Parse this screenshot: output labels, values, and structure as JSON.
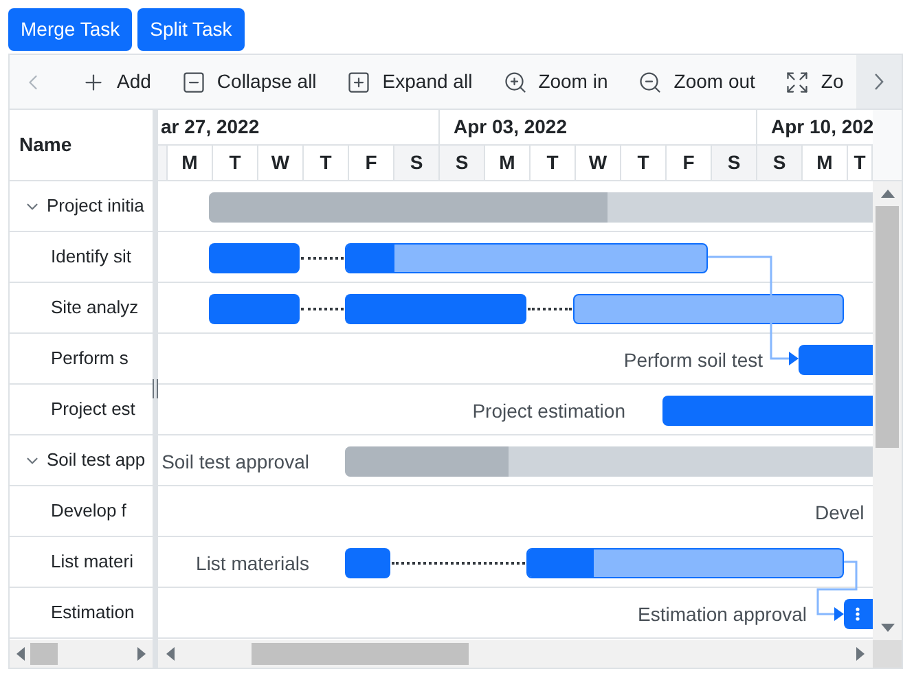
{
  "buttons": [
    {
      "label": "Merge Task"
    },
    {
      "label": "Split Task"
    }
  ],
  "toolbar": {
    "items": [
      {
        "kind": "add",
        "label": "Add"
      },
      {
        "kind": "collapse",
        "label": "Collapse all"
      },
      {
        "kind": "expand",
        "label": "Expand all"
      },
      {
        "kind": "zoom-in",
        "label": "Zoom in"
      },
      {
        "kind": "zoom-out",
        "label": "Zoom out"
      },
      {
        "kind": "zoom-fit",
        "label": "Zo"
      }
    ]
  },
  "grid": {
    "column": "Name"
  },
  "timeline": {
    "weeks": [
      {
        "label": "ar 27, 2022",
        "days": [
          {
            "label": "M",
            "weekend": false
          },
          {
            "label": "T",
            "weekend": false
          },
          {
            "label": "W",
            "weekend": false
          },
          {
            "label": "T",
            "weekend": false
          },
          {
            "label": "F",
            "weekend": false
          },
          {
            "label": "S",
            "weekend": true
          }
        ]
      },
      {
        "label": "Apr 03, 2022",
        "days": [
          {
            "label": "S",
            "weekend": true
          },
          {
            "label": "M",
            "weekend": false
          },
          {
            "label": "T",
            "weekend": false
          },
          {
            "label": "W",
            "weekend": false
          },
          {
            "label": "T",
            "weekend": false
          },
          {
            "label": "F",
            "weekend": false
          },
          {
            "label": "S",
            "weekend": true
          }
        ]
      },
      {
        "label": "Apr 10, 202",
        "days": [
          {
            "label": "S",
            "weekend": true
          },
          {
            "label": "M",
            "weekend": false
          },
          {
            "label": "T",
            "weekend": false
          }
        ]
      }
    ]
  },
  "tasks": [
    {
      "name": "Project initia",
      "expanded": true,
      "children": [
        {
          "name": "Identify sit"
        },
        {
          "name": "Site analyz"
        },
        {
          "name": "Perform s",
          "timeline_label": "Perform soil test"
        },
        {
          "name": "Project est",
          "timeline_label": "Project estimation"
        }
      ]
    },
    {
      "name": "Soil test app",
      "expanded": true,
      "timeline_label": "Soil test approval",
      "children": [
        {
          "name": "Develop f",
          "timeline_label": "Devel"
        },
        {
          "name": "List materi",
          "timeline_label": "List materials"
        },
        {
          "name": "Estimation",
          "timeline_label": "Estimation approval"
        }
      ]
    }
  ]
}
